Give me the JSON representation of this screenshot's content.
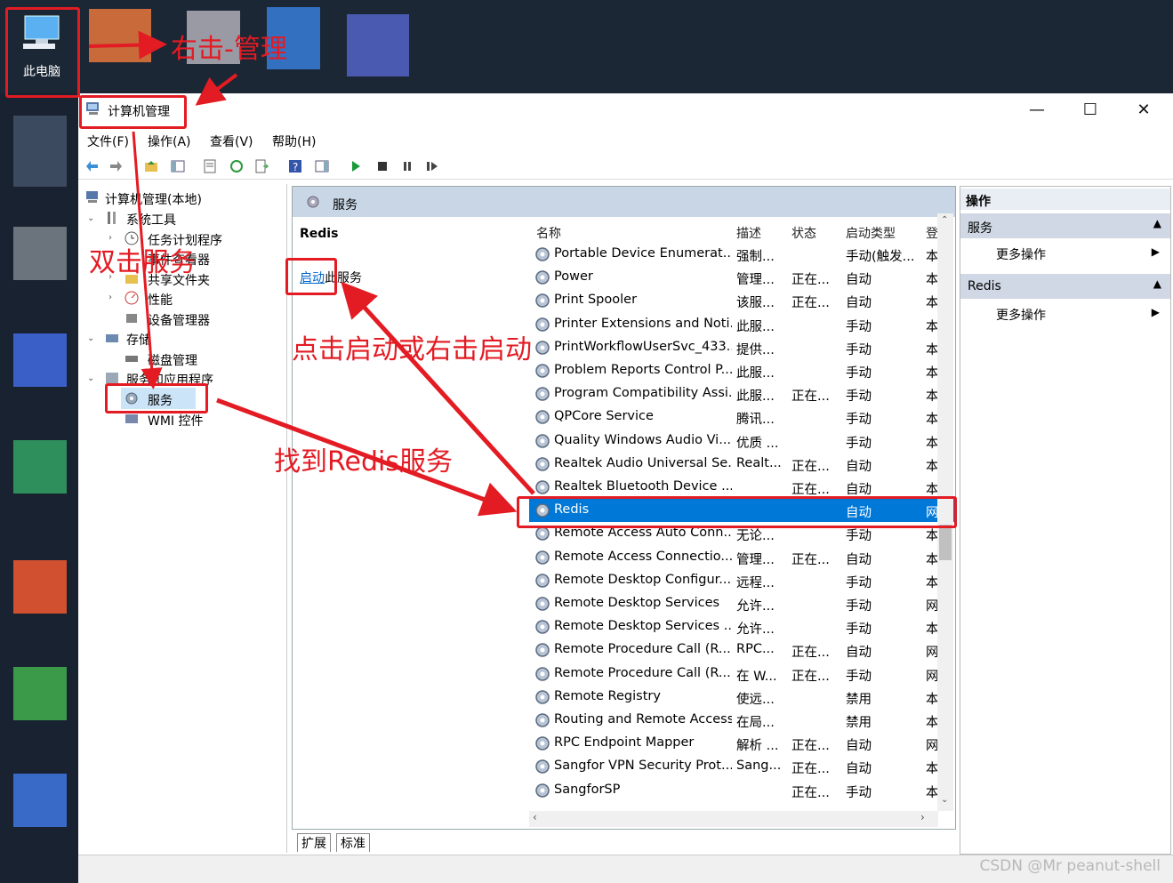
{
  "desktop": {
    "icon_label": "此电脑"
  },
  "annotations": {
    "right_click_manage": "右击-管理",
    "double_click_services": "双击服务",
    "click_start": "点击启动或右击启动",
    "find_redis": "找到Redis服务"
  },
  "window": {
    "title": "计算机管理",
    "minimize": "—",
    "maximize": "☐",
    "close": "✕"
  },
  "menu": [
    "文件(F)",
    "操作(A)",
    "查看(V)",
    "帮助(H)"
  ],
  "tree": {
    "root": "计算机管理(本地)",
    "system_tools": "系统工具",
    "task_scheduler": "任务计划程序",
    "event_viewer": "事件查看器",
    "shared_folders": "共享文件夹",
    "performance": "性能",
    "device_manager": "设备管理器",
    "storage": "存储",
    "disk_management": "磁盘管理",
    "services_apps": "服务和应用程序",
    "services": "服务",
    "wmi": "WMI 控件"
  },
  "middle": {
    "header": "服务",
    "detail_title": "Redis",
    "start_link": "启动",
    "start_suffix": "此服务",
    "columns": [
      "名称",
      "描述",
      "状态",
      "启动类型",
      "登"
    ],
    "rows": [
      {
        "name": "Portable Device Enumerat...",
        "desc": "强制...",
        "status": "",
        "startup": "手动(触发...",
        "logon": "本"
      },
      {
        "name": "Power",
        "desc": "管理...",
        "status": "正在...",
        "startup": "自动",
        "logon": "本"
      },
      {
        "name": "Print Spooler",
        "desc": "该服...",
        "status": "正在...",
        "startup": "自动",
        "logon": "本"
      },
      {
        "name": "Printer Extensions and Noti...",
        "desc": "此服...",
        "status": "",
        "startup": "手动",
        "logon": "本"
      },
      {
        "name": "PrintWorkflowUserSvc_433...",
        "desc": "提供...",
        "status": "",
        "startup": "手动",
        "logon": "本"
      },
      {
        "name": "Problem Reports Control P...",
        "desc": "此服...",
        "status": "",
        "startup": "手动",
        "logon": "本"
      },
      {
        "name": "Program Compatibility Assi...",
        "desc": "此服...",
        "status": "正在...",
        "startup": "手动",
        "logon": "本"
      },
      {
        "name": "QPCore Service",
        "desc": "腾讯...",
        "status": "",
        "startup": "手动",
        "logon": "本"
      },
      {
        "name": "Quality Windows Audio Vi...",
        "desc": "优质 ...",
        "status": "",
        "startup": "手动",
        "logon": "本"
      },
      {
        "name": "Realtek Audio Universal Se...",
        "desc": "Realt...",
        "status": "正在...",
        "startup": "自动",
        "logon": "本"
      },
      {
        "name": "Realtek Bluetooth Device ...",
        "desc": "",
        "status": "正在...",
        "startup": "自动",
        "logon": "本"
      },
      {
        "name": "Redis",
        "desc": "",
        "status": "",
        "startup": "自动",
        "logon": "网",
        "selected": true
      },
      {
        "name": "Remote Access Auto Conn...",
        "desc": "无论...",
        "status": "",
        "startup": "手动",
        "logon": "本"
      },
      {
        "name": "Remote Access Connectio...",
        "desc": "管理...",
        "status": "正在...",
        "startup": "自动",
        "logon": "本"
      },
      {
        "name": "Remote Desktop Configur...",
        "desc": "远程...",
        "status": "",
        "startup": "手动",
        "logon": "本"
      },
      {
        "name": "Remote Desktop Services",
        "desc": "允许...",
        "status": "",
        "startup": "手动",
        "logon": "网"
      },
      {
        "name": "Remote Desktop Services ...",
        "desc": "允许...",
        "status": "",
        "startup": "手动",
        "logon": "本"
      },
      {
        "name": "Remote Procedure Call (R...",
        "desc": "RPC...",
        "status": "正在...",
        "startup": "自动",
        "logon": "网"
      },
      {
        "name": "Remote Procedure Call (R...",
        "desc": "在 W...",
        "status": "正在...",
        "startup": "手动",
        "logon": "网"
      },
      {
        "name": "Remote Registry",
        "desc": "使远...",
        "status": "",
        "startup": "禁用",
        "logon": "本"
      },
      {
        "name": "Routing and Remote Access",
        "desc": "在局...",
        "status": "",
        "startup": "禁用",
        "logon": "本"
      },
      {
        "name": "RPC Endpoint Mapper",
        "desc": "解析 ...",
        "status": "正在...",
        "startup": "自动",
        "logon": "网"
      },
      {
        "name": "Sangfor VPN Security Prot...",
        "desc": "Sang...",
        "status": "正在...",
        "startup": "自动",
        "logon": "本"
      },
      {
        "name": "SangforSP",
        "desc": "",
        "status": "正在...",
        "startup": "手动",
        "logon": "本"
      }
    ],
    "tabs": [
      "扩展",
      "标准"
    ]
  },
  "actions": {
    "header": "操作",
    "section1": "服务",
    "section1_item": "更多操作",
    "section2": "Redis",
    "section2_item": "更多操作"
  },
  "watermark": "CSDN @Mr peanut-shell",
  "colors": {
    "selection": "#0078d7",
    "annotation_red": "#e31b23",
    "link": "#0066cc"
  }
}
